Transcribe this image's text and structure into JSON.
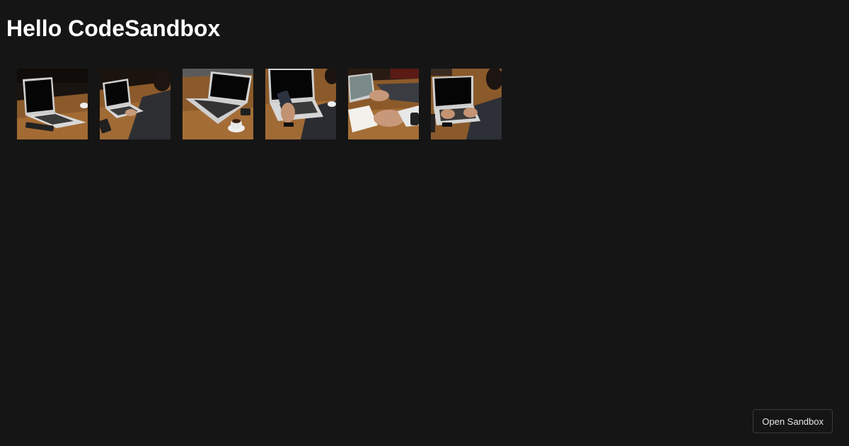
{
  "page": {
    "title": "Hello CodeSandbox"
  },
  "gallery": {
    "images": [
      {
        "subject": "laptop-on-wooden-table"
      },
      {
        "subject": "person-typing-on-laptop"
      },
      {
        "subject": "laptop-and-coffee-cup"
      },
      {
        "subject": "person-holding-phone-at-laptop"
      },
      {
        "subject": "person-writing-in-notebook"
      },
      {
        "subject": "person-typing-on-laptop-front"
      }
    ]
  },
  "sandbox_button": {
    "label": "Open Sandbox"
  }
}
